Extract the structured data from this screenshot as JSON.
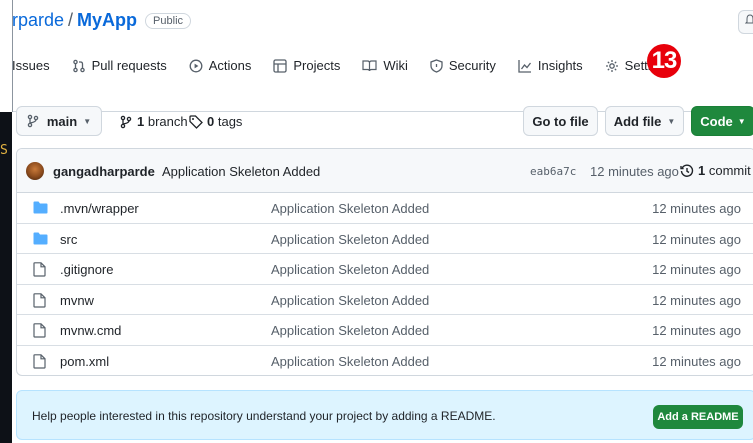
{
  "repo": {
    "owner": "rparde",
    "separator": "/",
    "name": "MyApp",
    "visibility": "Public"
  },
  "nav": {
    "items": [
      {
        "label": "Issues",
        "icon": "issue-icon"
      },
      {
        "label": "Pull requests",
        "icon": "pull-request-icon"
      },
      {
        "label": "Actions",
        "icon": "play-icon"
      },
      {
        "label": "Projects",
        "icon": "table-icon"
      },
      {
        "label": "Wiki",
        "icon": "book-icon"
      },
      {
        "label": "Security",
        "icon": "shield-icon"
      },
      {
        "label": "Insights",
        "icon": "graph-icon"
      },
      {
        "label": "Settings",
        "icon": "gear-icon"
      }
    ]
  },
  "annotation_badge": "13",
  "left_strip_char": "S",
  "branch_bar": {
    "branch": "main",
    "branch_count": "1",
    "branch_label": "branch",
    "tag_count": "0",
    "tag_label": "tags",
    "goto_label": "Go to file",
    "add_file_label": "Add file",
    "code_label": "Code"
  },
  "commit": {
    "author": "gangadharparde",
    "message": "Application Skeleton Added",
    "hash": "eab6a7c",
    "time": "12 minutes ago",
    "count": "1",
    "count_label": "commit"
  },
  "files": [
    {
      "name": ".mvn/wrapper",
      "type": "folder",
      "commit": "Application Skeleton Added",
      "time": "12 minutes ago"
    },
    {
      "name": "src",
      "type": "folder",
      "commit": "Application Skeleton Added",
      "time": "12 minutes ago"
    },
    {
      "name": ".gitignore",
      "type": "file",
      "commit": "Application Skeleton Added",
      "time": "12 minutes ago"
    },
    {
      "name": "mvnw",
      "type": "file",
      "commit": "Application Skeleton Added",
      "time": "12 minutes ago"
    },
    {
      "name": "mvnw.cmd",
      "type": "file",
      "commit": "Application Skeleton Added",
      "time": "12 minutes ago"
    },
    {
      "name": "pom.xml",
      "type": "file",
      "commit": "Application Skeleton Added",
      "time": "12 minutes ago"
    }
  ],
  "readme": {
    "text": "Help people interested in this repository understand your project by adding a README.",
    "button": "Add a README"
  },
  "colors": {
    "link": "#0969da",
    "primary_button": "#1f883d",
    "badge_red": "#e8000b",
    "folder": "#54aeff",
    "banner_bg": "#ddf4ff"
  }
}
